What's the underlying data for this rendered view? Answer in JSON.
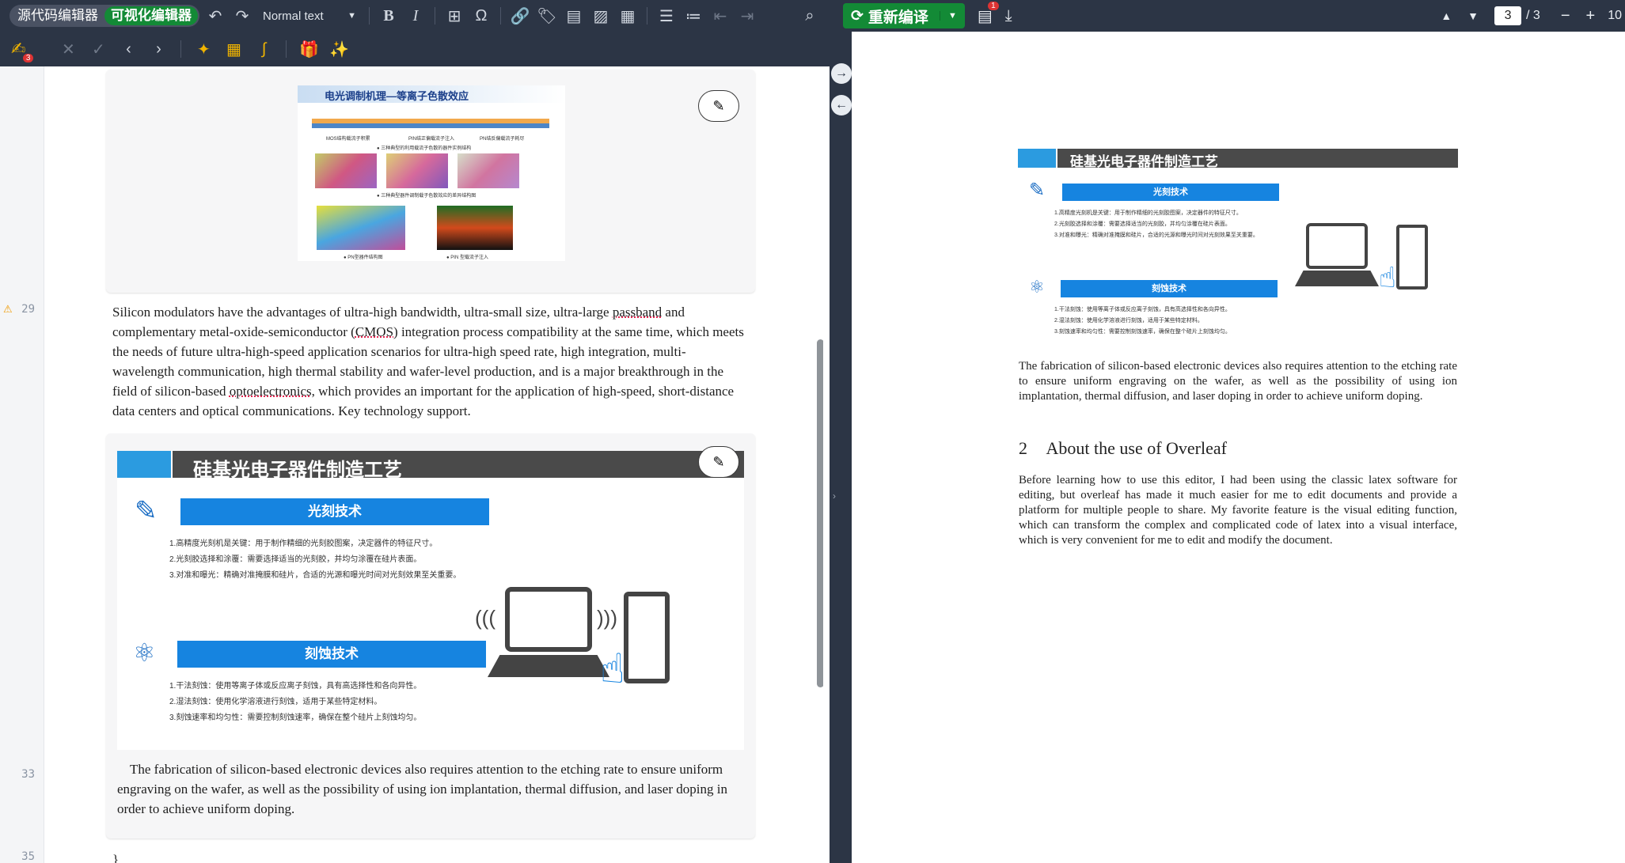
{
  "toolbar": {
    "source_editor": "源代码编辑器",
    "visual_editor": "可视化编辑器",
    "style_select": "Normal text",
    "badge_count": "3"
  },
  "editor": {
    "line_numbers": [
      "29",
      "33",
      "35"
    ],
    "figure1": {
      "title": "电光调制机理—等离子色散效应",
      "sub1": "MOS结构载流子积累",
      "sub2": "PIN结正偏载流子注入",
      "sub3": "PN结反偏载流子耗尽",
      "note1": "● 三种典型的利用载流子色散的器件实例结构",
      "note2": "● 三种典型器件调制载子色散效应的差异结构图",
      "cap1": "● PN型器件结构图",
      "cap2": "● PIN 型载流子注入"
    },
    "para29": [
      {
        "t": "Silicon modulators have the advantages of ultra-high bandwidth, ultra-small size, ultra-large ",
        "u": false
      },
      {
        "t": "passband",
        "u": true
      },
      {
        "t": " and complementary metal-oxide-semiconductor (",
        "u": false
      },
      {
        "t": "CMOS",
        "u": true
      },
      {
        "t": ") integration process compatibility at the same time, which meets the needs of future ultra-high-speed application scenarios for ultra-high speed rate, high integration, multi-wavelength communication, high thermal stability and wafer-level production, and is a major breakthrough in the field of silicon-based ",
        "u": false
      },
      {
        "t": "optoelectronics",
        "u": true
      },
      {
        "t": ", which provides an important for the application of high-speed, short-distance data centers and optical communications. Key technology support.",
        "u": false
      }
    ],
    "figure2": {
      "banner": "硅基光电子器件制造工艺",
      "section1": "光刻技术",
      "s1_items": [
        "1.高精度光刻机是关键：用于制作精细的光刻胶图案，决定器件的特征尺寸。",
        "2.光刻胶选择和涂覆：需要选择适当的光刻胶，并均匀涂覆在硅片表面。",
        "3.对准和曝光：精确对准掩膜和硅片，合适的光源和曝光时间对光刻效果至关重要。"
      ],
      "section2": "刻蚀技术",
      "s2_items": [
        "1.干法刻蚀：使用等离子体或反应离子刻蚀，具有高选择性和各向异性。",
        "2.湿法刻蚀：使用化学溶液进行刻蚀，适用于某些特定材料。",
        "3.刻蚀速率和均匀性：需要控制刻蚀速率，确保在整个硅片上刻蚀均匀。"
      ]
    },
    "para33": "The fabrication of silicon-based electronic devices also requires attention to the etching rate to ensure uniform engraving on the wafer, as well as the possibility of using ion implantation, thermal diffusion, and laser doping in order to achieve uniform doping.",
    "line35": "}"
  },
  "pdf_toolbar": {
    "recompile": "重新编译",
    "page_current": "3",
    "page_total": "/ 3",
    "zoom": "10",
    "log_badge": "1"
  },
  "pdf": {
    "para1": "The fabrication of silicon-based electronic devices also requires attention to the etching rate to ensure uniform engraving on the wafer, as well as the possibility of using ion implantation, thermal diffusion, and laser doping in order to achieve uniform doping.",
    "section_num": "2",
    "section_title": "About the use of Overleaf",
    "para2": "Before learning how to use this editor, I had been using the classic latex software for editing, but overleaf has made it much easier for me to edit documents and provide a platform for multiple people to share. My favorite feature is the visual editing function, which can transform the complex and complicated code of latex into a visual interface, which is very convenient for me to edit and modify the document."
  }
}
